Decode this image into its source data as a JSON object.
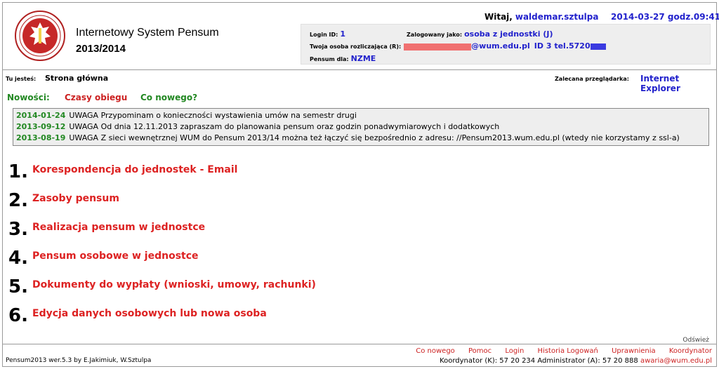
{
  "header": {
    "system_title": "Internetowy System Pensum",
    "year": "2013/2014",
    "welcome_label": "Witaj,",
    "username": "waldemar.sztulpa",
    "datetime": "2014-03-27 godz.09:41",
    "login_id_label": "Login ID:",
    "login_id": "1",
    "logged_as_label": "Zalogowany jako:",
    "logged_as": "osoba z jednostki (J)",
    "settler_label": "Twoja osoba rozliczająca (R):",
    "settler_email_domain": "@wum.edu.pl",
    "settler_id": "ID 3 tel.5720",
    "pensum_for_label": "Pensum dla:",
    "pensum_for": "NZME"
  },
  "breadcrumb": {
    "label": "Tu jesteś:",
    "current": "Strona główna",
    "browser_label": "Zalecana przeglądarka:",
    "browser": "Internet Explorer"
  },
  "tabs": [
    {
      "label": "Nowości:"
    },
    {
      "label": "Czasy obiegu"
    },
    {
      "label": "Co nowego?"
    }
  ],
  "news": [
    {
      "date": "2014-01-24",
      "text": "UWAGA Przypominam o konieczności wystawienia umów na semestr drugi"
    },
    {
      "date": "2013-09-12",
      "text": "UWAGA Od dnia 12.11.2013 zapraszam do planowania pensum oraz godzin ponadwymiarowych i dodatkowych"
    },
    {
      "date": "2013-08-19",
      "text": "UWAGA Z sieci wewnętrznej WUM do Pensum 2013/14 można też łączyć się bezpośrednio z adresu: //Pensum2013.wum.edu.pl (wtedy nie korzystamy z ssl-a)"
    }
  ],
  "menu": [
    {
      "num": "1.",
      "label": "Korespondencja do jednostek - Email"
    },
    {
      "num": "2.",
      "label": "Zasoby pensum"
    },
    {
      "num": "3.",
      "label": "Realizacja pensum w jednostce"
    },
    {
      "num": "4.",
      "label": "Pensum osobowe w jednostce"
    },
    {
      "num": "5.",
      "label": "Dokumenty do wypłaty (wnioski, umowy, rachunki)"
    },
    {
      "num": "6.",
      "label": "Edycja danych osobowych lub nowa osoba"
    }
  ],
  "refresh_label": "Odśwież",
  "footer": {
    "version": "Pensum2013 wer.5.3 by E.Jakimiuk, W.Sztulpa",
    "links": [
      "Co nowego",
      "Pomoc",
      "Login",
      "Historia Logowań",
      "Uprawnienia",
      "Koordynator"
    ],
    "contact": "Koordynator (K): 57 20 234 Administrator (A): 57 20 888",
    "email": "awaria@wum.edu.pl"
  },
  "colors": {
    "accent_blue": "#2222cc",
    "link_red": "#dd2222",
    "date_green": "#228822"
  }
}
